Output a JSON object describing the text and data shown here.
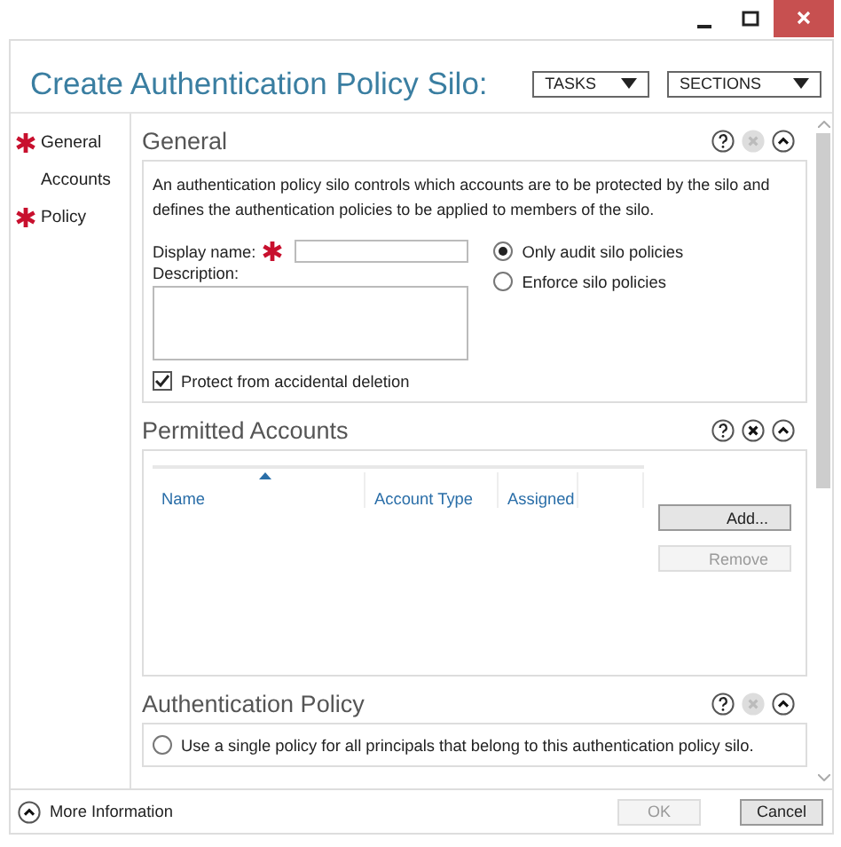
{
  "title": "Create Authentication Policy Silo:",
  "header_buttons": [
    {
      "label": "TASKS"
    },
    {
      "label": "SECTIONS"
    }
  ],
  "nav": [
    {
      "label": "General",
      "required": true
    },
    {
      "label": "Accounts",
      "required": false
    },
    {
      "label": "Policy",
      "required": true
    }
  ],
  "general": {
    "title": "General",
    "close_enabled": false,
    "description": "An authentication policy silo controls which accounts are to be protected by the silo and defines the authentication policies to be applied to members of the silo.",
    "display_name_label": "Display name:",
    "description_label": "Description:",
    "protect": {
      "label": "Protect from accidental deletion",
      "checked": true
    },
    "modes": [
      {
        "label": "Only audit silo policies",
        "selected": true
      },
      {
        "label": "Enforce silo policies",
        "selected": false
      }
    ]
  },
  "accounts": {
    "title": "Permitted Accounts",
    "close_enabled": true,
    "columns": [
      "Name",
      "Account Type",
      "Assigned"
    ],
    "buttons": [
      {
        "label": "Add...",
        "disabled": false
      },
      {
        "label": "Remove",
        "disabled": true
      }
    ]
  },
  "policy": {
    "title": "Authentication Policy",
    "close_enabled": false,
    "options": [
      {
        "label": "Use a single policy for all principals that belong to this authentication policy silo.",
        "selected": false
      }
    ]
  },
  "more_info": "More Information",
  "footer_buttons": [
    {
      "label": "OK",
      "disabled": true
    },
    {
      "label": "Cancel",
      "disabled": false
    }
  ]
}
